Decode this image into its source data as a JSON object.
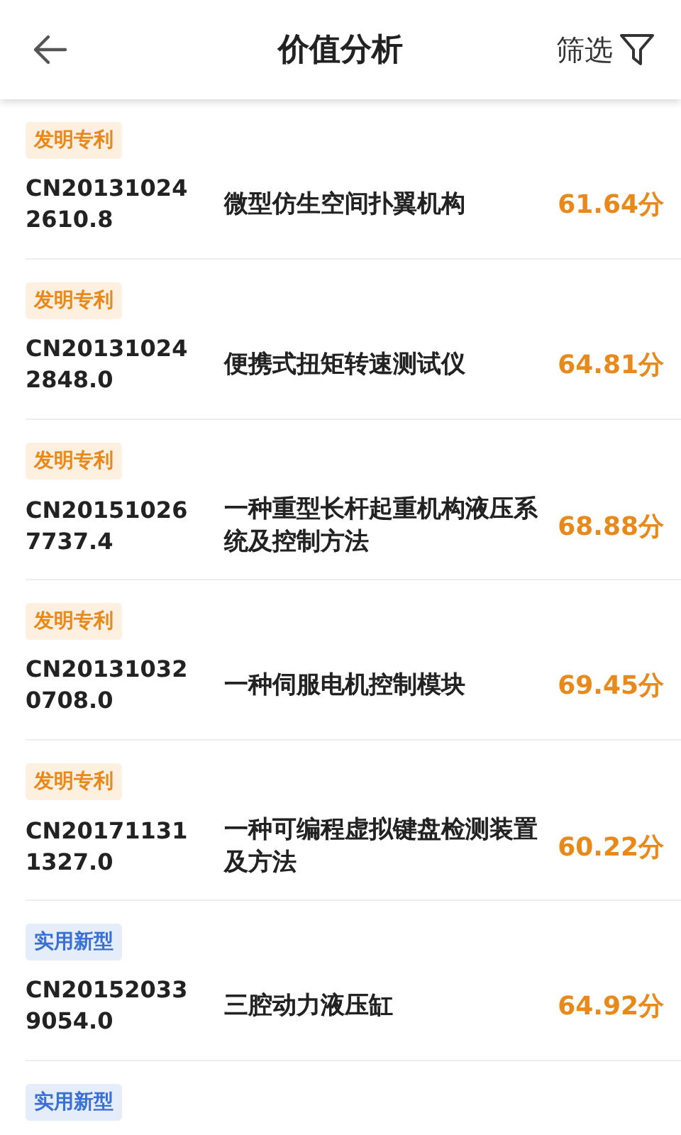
{
  "header": {
    "title": "价值分析",
    "filter_label": "筛选"
  },
  "patents": [
    {
      "tag": {
        "kind": "invention",
        "label": "发明专利"
      },
      "number": [
        "CN20131024",
        "2610.8"
      ],
      "title": "微型仿生空间扑翼机构",
      "score": "61.64分"
    },
    {
      "tag": {
        "kind": "invention",
        "label": "发明专利"
      },
      "number": [
        "CN20131024",
        "2848.0"
      ],
      "title": "便携式扭矩转速测试仪",
      "score": "64.81分"
    },
    {
      "tag": {
        "kind": "invention",
        "label": "发明专利"
      },
      "number": [
        "CN20151026",
        "7737.4"
      ],
      "title": "一种重型长杆起重机构液压系统及控制方法",
      "score": "68.88分"
    },
    {
      "tag": {
        "kind": "invention",
        "label": "发明专利"
      },
      "number": [
        "CN20131032",
        "0708.0"
      ],
      "title": "一种伺服电机控制模块",
      "score": "69.45分"
    },
    {
      "tag": {
        "kind": "invention",
        "label": "发明专利"
      },
      "number": [
        "CN20171131",
        "1327.0"
      ],
      "title": "一种可编程虚拟键盘检测装置及方法",
      "score": "60.22分"
    },
    {
      "tag": {
        "kind": "utility",
        "label": "实用新型"
      },
      "number": [
        "CN20152033",
        "9054.0"
      ],
      "title": "三腔动力液压缸",
      "score": "64.92分"
    },
    {
      "tag": {
        "kind": "utility",
        "label": "实用新型"
      }
    }
  ]
}
